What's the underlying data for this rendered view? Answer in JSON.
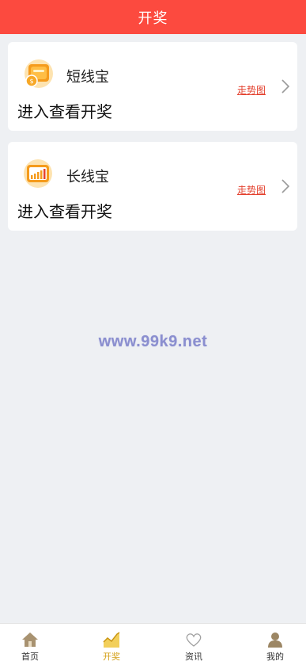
{
  "header": {
    "title": "开奖"
  },
  "cards": [
    {
      "name": "短线宝",
      "enter_text": "进入查看开奖",
      "trend_label": "走势图",
      "icon": "coin-stack-icon"
    },
    {
      "name": "长线宝",
      "enter_text": "进入查看开奖",
      "trend_label": "走势图",
      "icon": "bar-chart-icon"
    }
  ],
  "watermark": "www.99k9.net",
  "tabbar": {
    "items": [
      {
        "label": "首页",
        "icon": "home-icon"
      },
      {
        "label": "开奖",
        "icon": "trend-chart-icon",
        "active": true
      },
      {
        "label": "资讯",
        "icon": "heart-icon"
      },
      {
        "label": "我的",
        "icon": "user-icon"
      }
    ]
  },
  "colors": {
    "header_bg": "#fc4a3f",
    "trend_link": "#e4412e",
    "active_tab": "#d4a017",
    "page_bg": "#eef0f3"
  }
}
